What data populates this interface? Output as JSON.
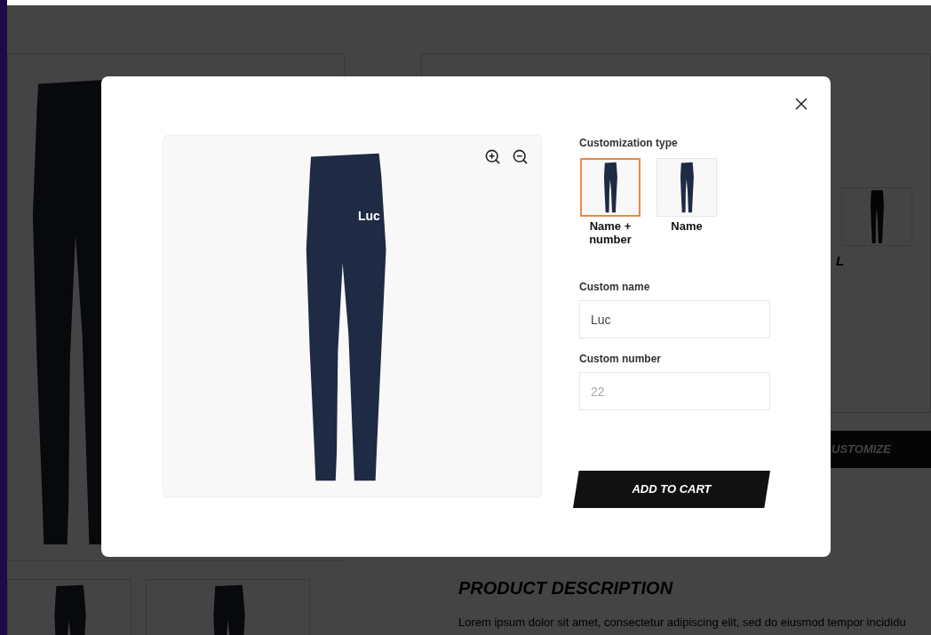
{
  "background_page": {
    "customize_button": "USTOMIZE",
    "cut_label": "L",
    "description": {
      "heading": "PRODUCT DESCRIPTION",
      "text": "Lorem ipsum dolor sit amet, consectetur adipiscing elit, sed do eiusmod tempor incididu"
    }
  },
  "modal": {
    "preview": {
      "print_text": "Luc"
    },
    "customization_type": {
      "label": "Customization type",
      "options": [
        {
          "label": "Name + number",
          "selected": true
        },
        {
          "label": "Name",
          "selected": false
        }
      ]
    },
    "fields": [
      {
        "label": "Custom name",
        "value": "Luc"
      },
      {
        "label": "Custom number",
        "placeholder": "22"
      }
    ],
    "add_to_cart": "ADD TO CART"
  }
}
